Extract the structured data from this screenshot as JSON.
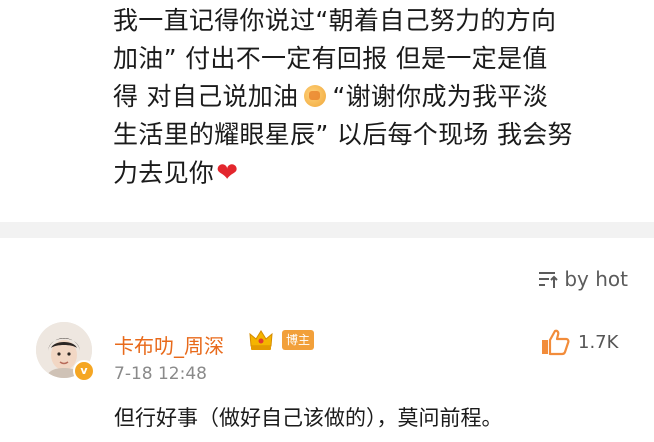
{
  "post": {
    "lines": [
      "我一直记得你说过“朝着自己努力的方向",
      "加油”   付出不一定有回报 但是一定是值",
      "得 对自己说加油",
      "“谢谢你成为我平淡",
      "生活里的耀眼星辰” 以后每个现场 我会努",
      "力去见你"
    ]
  },
  "comments": {
    "sort_label": "by hot",
    "items": [
      {
        "username": "卡布叻_周深",
        "badge": "博主",
        "time": "7-18 12:48",
        "like_count": "1.7K",
        "text": "但行好事（做好自己该做的），莫问前程。"
      }
    ]
  },
  "colors": {
    "username": "#e86a1b",
    "badge": "#f2a03a",
    "heart": "#e3262d"
  },
  "icons": [
    "fist-emoji-icon",
    "heart-emoji-icon",
    "sort-icon",
    "crown-icon",
    "verified-icon",
    "like-icon"
  ]
}
